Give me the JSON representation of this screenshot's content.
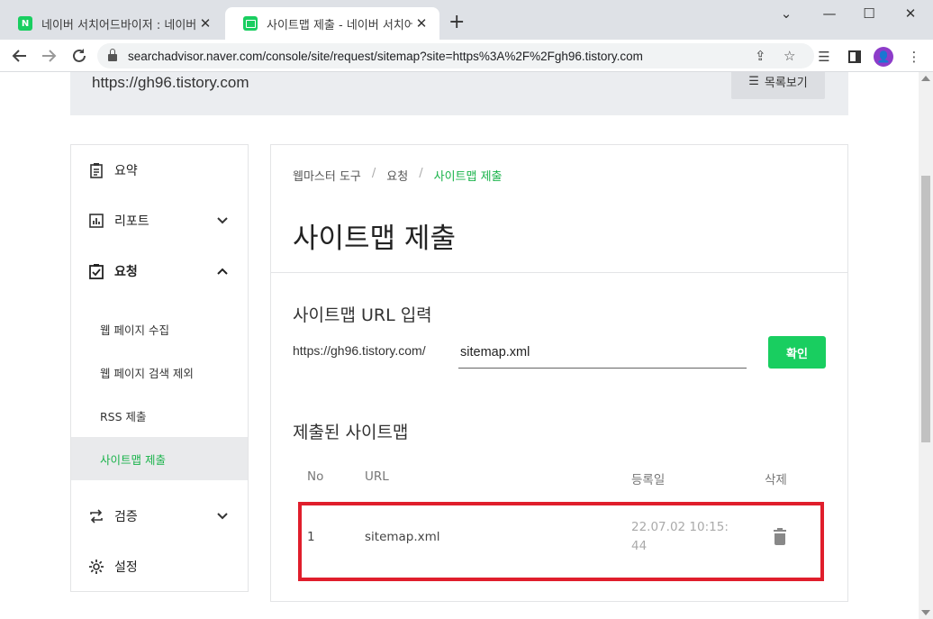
{
  "browser": {
    "tabs": [
      {
        "title": "네이버 서치어드바이저 : 네이버",
        "favicon": "N",
        "active": false
      },
      {
        "title": "사이트맵 제출 - 네이버 서치어드",
        "active": true
      }
    ],
    "new_tab": "+",
    "window_controls": {
      "dropdown": "⌄",
      "minimize": "—",
      "maximize": "☐",
      "close": "✕"
    },
    "url": "searchadvisor.naver.com/console/site/request/sitemap?site=https%3A%2F%2Fgh96.tistory.com",
    "profile_initial": "👤"
  },
  "site": {
    "url": "https://gh96.tistory.com",
    "list_button": "목록보기"
  },
  "sidebar": {
    "items": [
      {
        "label": "요약",
        "icon": "clipboard-icon"
      },
      {
        "label": "리포트",
        "icon": "chart-icon",
        "chevron": "down"
      },
      {
        "label": "요청",
        "icon": "checked-clipboard-icon",
        "chevron": "up"
      },
      {
        "label": "검증",
        "icon": "repeat-icon",
        "chevron": "down"
      },
      {
        "label": "설정",
        "icon": "gear-icon"
      }
    ],
    "sub_items": [
      {
        "label": "웹 페이지 수집"
      },
      {
        "label": "웹 페이지 검색 제외"
      },
      {
        "label": "RSS 제출"
      },
      {
        "label": "사이트맵 제출",
        "selected": true
      }
    ]
  },
  "main": {
    "breadcrumb": [
      "웹마스터 도구",
      "요청",
      "사이트맵 제출"
    ],
    "page_title": "사이트맵 제출",
    "url_section_title": "사이트맵 URL 입력",
    "url_prefix": "https://gh96.tistory.com/",
    "url_input_value": "sitemap.xml",
    "confirm_button": "확인",
    "submitted_title": "제출된 사이트맵",
    "table": {
      "headers": [
        "No",
        "URL",
        "등록일",
        "삭제"
      ],
      "rows": [
        {
          "no": "1",
          "url": "sitemap.xml",
          "date_line1": "22.07.02 10:15:",
          "date_line2": "44"
        }
      ]
    }
  },
  "colors": {
    "accent_green": "#19ce60",
    "highlight_red": "#e01e2c"
  }
}
